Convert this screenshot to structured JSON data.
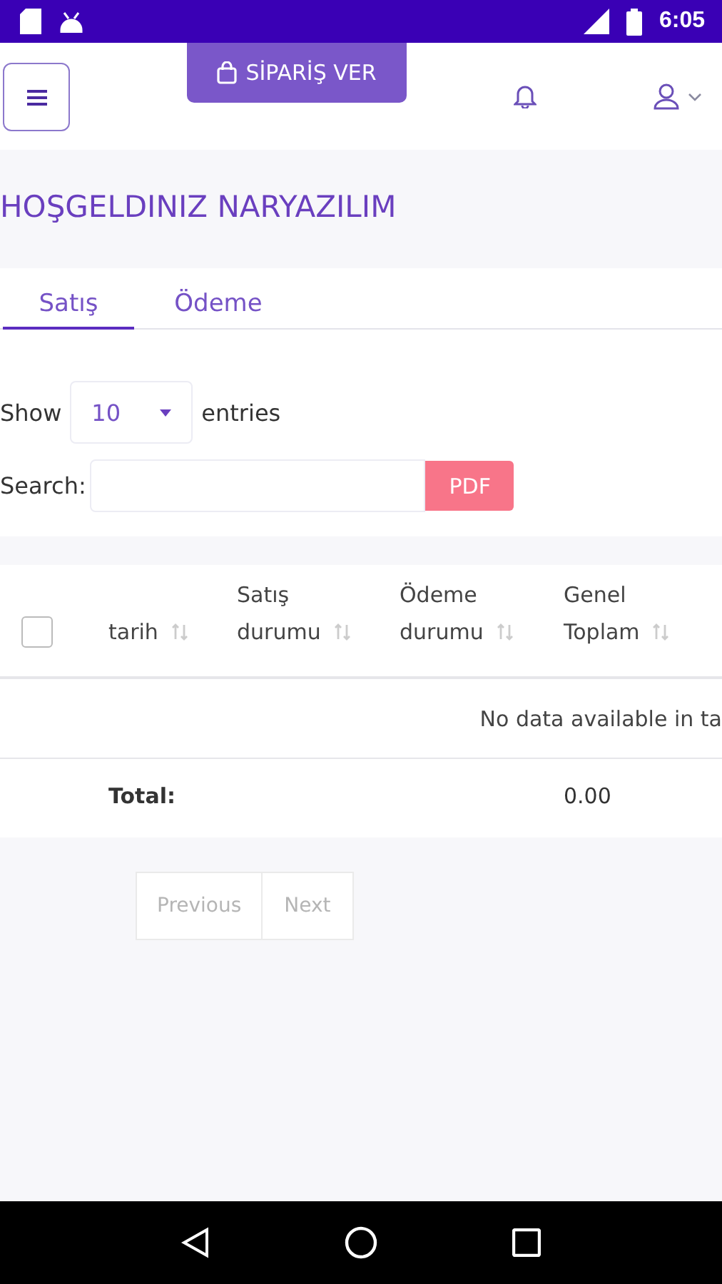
{
  "status_bar": {
    "time": "6:05"
  },
  "header": {
    "order_button": "SİPARİŞ VER"
  },
  "title": "HOŞGELDINIZ NARYAZILIM",
  "tabs": [
    {
      "label": "Satış",
      "selected": true
    },
    {
      "label": "Ödeme",
      "selected": false
    }
  ],
  "length": {
    "before": "Show",
    "value": "10",
    "after": "entries"
  },
  "search": {
    "label": "Search:",
    "export_button": "PDF"
  },
  "table": {
    "select_all": {
      "checked": false
    },
    "columns": [
      [
        "tarih"
      ],
      [
        "Satış",
        "durumu"
      ],
      [
        "Ödeme",
        "durumu"
      ],
      [
        "Genel",
        "Toplam"
      ]
    ],
    "empty_message": "No data available in ta",
    "footer": {
      "label": "Total:",
      "total": "0.00"
    }
  },
  "pagination": [
    {
      "label": "Previous",
      "disabled": true
    },
    {
      "label": "Next",
      "disabled": true
    }
  ]
}
